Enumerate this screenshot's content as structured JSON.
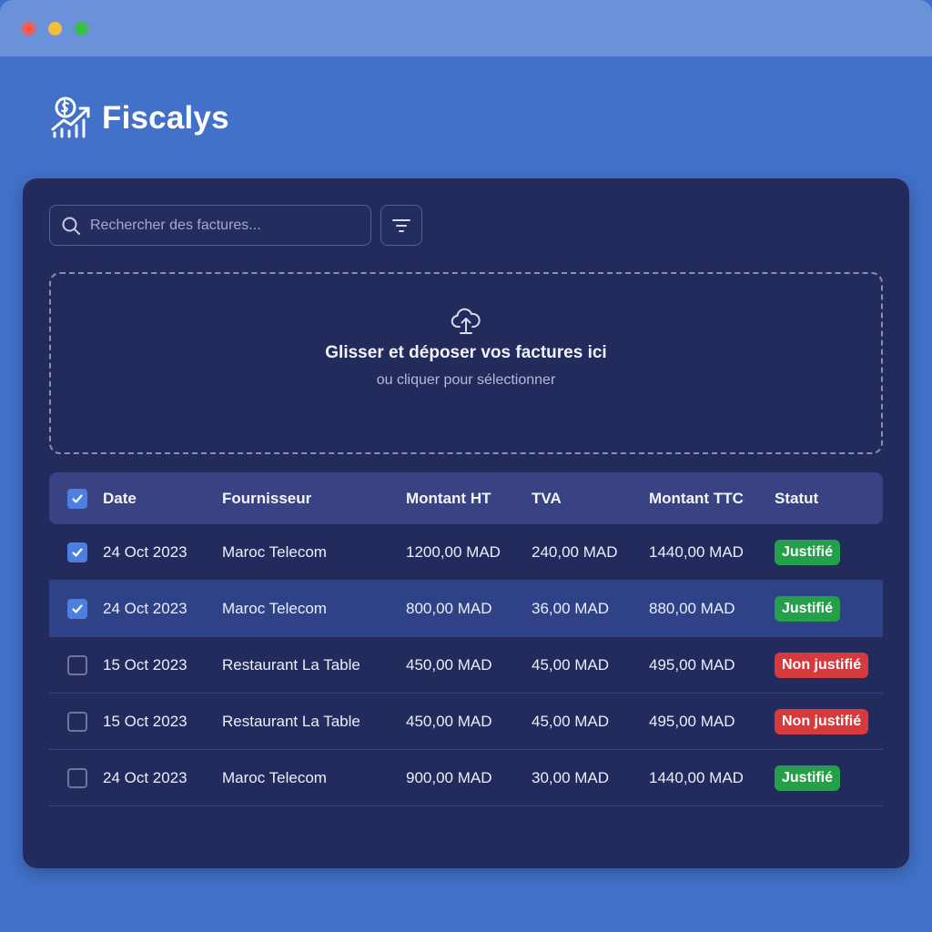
{
  "window": {
    "controls": [
      "close",
      "minimize",
      "maximize"
    ],
    "colors": {
      "close": "#ee5f57",
      "minimize": "#f2be3b",
      "maximize": "#35c04a"
    }
  },
  "brand": {
    "name": "Fiscalys",
    "logo_icon": "dollar-growth-chart-icon"
  },
  "toolbar": {
    "search_placeholder": "Rechercher des factures...",
    "search_icon": "search-icon",
    "filter_icon": "filter-icon"
  },
  "dropzone": {
    "icon": "cloud-upload-icon",
    "title": "Glisser et déposer vos factures ici",
    "subtitle": "ou cliquer pour sélectionner"
  },
  "table": {
    "header_checked": true,
    "columns": [
      "Date",
      "Fournisseur",
      "Montant HT",
      "TVA",
      "Montant TTC",
      "Statut"
    ],
    "rows": [
      {
        "checked": true,
        "highlighted": false,
        "date": "24 Oct 2023",
        "supplier": "Maroc Telecom",
        "ht": "1200,00 MAD",
        "tva": "240,00 MAD",
        "ttc": "1440,00 MAD",
        "status": "Justifié",
        "status_type": "ok"
      },
      {
        "checked": true,
        "highlighted": true,
        "date": "24 Oct 2023",
        "supplier": "Maroc Telecom",
        "ht": "800,00 MAD",
        "tva": "36,00 MAD",
        "ttc": "880,00 MAD",
        "status": "Justifié",
        "status_type": "ok"
      },
      {
        "checked": false,
        "highlighted": false,
        "date": "15 Oct 2023",
        "supplier": "Restaurant La Table",
        "ht": "450,00 MAD",
        "tva": "45,00 MAD",
        "ttc": "495,00 MAD",
        "status": "Non justifié",
        "status_type": "ko"
      },
      {
        "checked": false,
        "highlighted": false,
        "date": "15 Oct 2023",
        "supplier": "Restaurant La Table",
        "ht": "450,00 MAD",
        "tva": "45,00 MAD",
        "ttc": "495,00 MAD",
        "status": "Non justifié",
        "status_type": "ko"
      },
      {
        "checked": false,
        "highlighted": false,
        "date": "24 Oct 2023",
        "supplier": "Maroc Telecom",
        "ht": "900,00 MAD",
        "tva": "30,00 MAD",
        "ttc": "1440,00 MAD",
        "status": "Justifié",
        "status_type": "ok"
      }
    ]
  },
  "colors": {
    "background": "#4271c9",
    "panel": "#232a5c",
    "accent": "#4d7fe0",
    "status_ok": "#25a04a",
    "status_ko": "#d63a3d"
  }
}
